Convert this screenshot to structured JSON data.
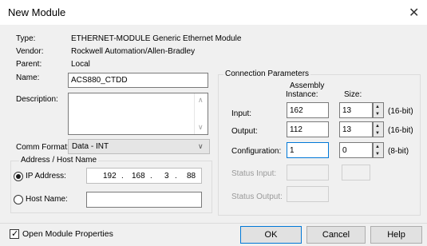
{
  "window": {
    "title": "New Module",
    "close_glyph": "✕"
  },
  "info": {
    "type_label": "Type:",
    "type_value": "ETHERNET-MODULE Generic Ethernet Module",
    "vendor_label": "Vendor:",
    "vendor_value": "Rockwell Automation/Allen-Bradley",
    "parent_label": "Parent:",
    "parent_value": "Local"
  },
  "name": {
    "label": "Name:",
    "value": "ACS880_CTDD"
  },
  "description": {
    "label": "Description:",
    "value": ""
  },
  "comm_format": {
    "label": "Comm Format:",
    "value": "Data - INT"
  },
  "address": {
    "group_title": "Address / Host Name",
    "ip_label": "IP Address:",
    "ip_selected": true,
    "ip_octets": [
      "192",
      "168",
      "3",
      "88"
    ],
    "host_label": "Host Name:",
    "host_value": ""
  },
  "connection": {
    "group_title": "Connection Parameters",
    "col_assembly": "Assembly",
    "col_instance": "Instance:",
    "col_size": "Size:",
    "rows": [
      {
        "label": "Input:",
        "instance": "162",
        "size": "13",
        "unit": "(16-bit)"
      },
      {
        "label": "Output:",
        "instance": "112",
        "size": "13",
        "unit": "(16-bit)"
      },
      {
        "label": "Configuration:",
        "instance": "1",
        "size": "0",
        "unit": "(8-bit)"
      }
    ],
    "status_input_label": "Status Input:",
    "status_output_label": "Status Output:"
  },
  "footer": {
    "open_props_label": "Open Module Properties",
    "open_props_checked": true,
    "ok_label": "OK",
    "cancel_label": "Cancel",
    "help_label": "Help"
  }
}
